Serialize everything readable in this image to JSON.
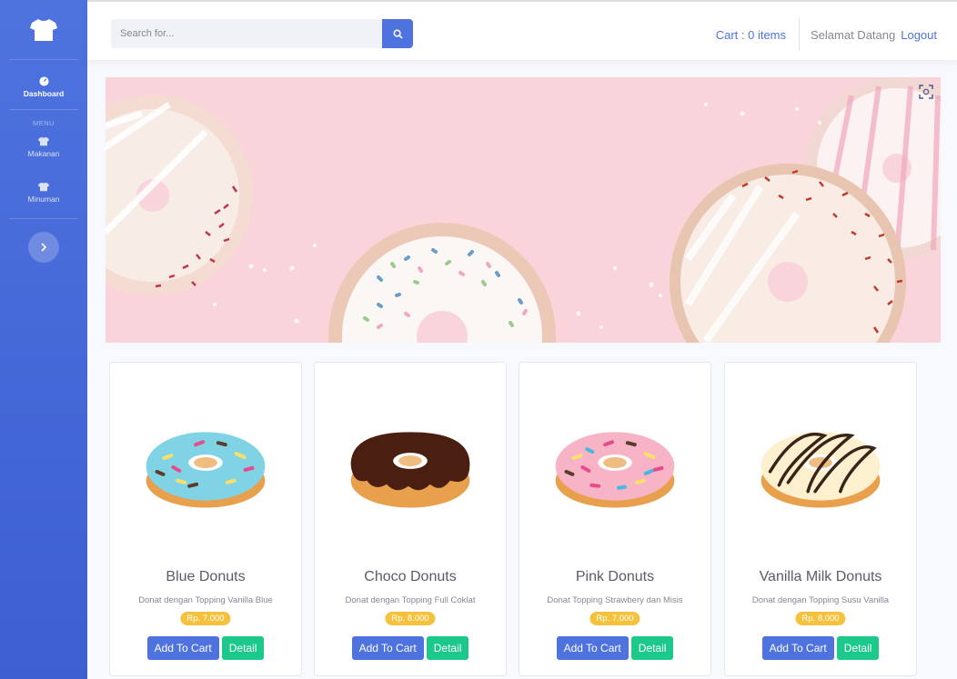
{
  "sidebar": {
    "brand_icon": "shirt-icon",
    "dashboard": "Dashboard",
    "heading": "MENU",
    "items": [
      {
        "label": "Makanan",
        "icon": "shirt-icon"
      },
      {
        "label": "Minuman",
        "icon": "shirt-icon"
      }
    ],
    "toggle_icon": "chevron-right-icon"
  },
  "topbar": {
    "search_placeholder": "Search for...",
    "cart": "Cart : 0 items",
    "greeting": "Selamat Datang",
    "logout": "Logout"
  },
  "products": [
    {
      "name": "Blue Donuts",
      "desc": "Donat dengan Topping Vanilla Blue",
      "price": "Rp. 7.000",
      "add": "Add To Cart",
      "detail": "Detail"
    },
    {
      "name": "Choco Donuts",
      "desc": "Donat dengan Topping Full Coklat",
      "price": "Rp. 8.000",
      "add": "Add To Cart",
      "detail": "Detail"
    },
    {
      "name": "Pink Donuts",
      "desc": "Donat Topping Strawbery dan Misis",
      "price": "Rp. 7.000",
      "add": "Add To Cart",
      "detail": "Detail"
    },
    {
      "name": "Vanilla Milk Donuts",
      "desc": "Donat dengan Topping Susu Vanilla",
      "price": "Rp. 8.000",
      "add": "Add To Cart",
      "detail": "Detail"
    }
  ],
  "colors": {
    "primary": "#4e73df",
    "success": "#1cc88a",
    "warning": "#f6c23e",
    "banner": "#f9d4da"
  }
}
